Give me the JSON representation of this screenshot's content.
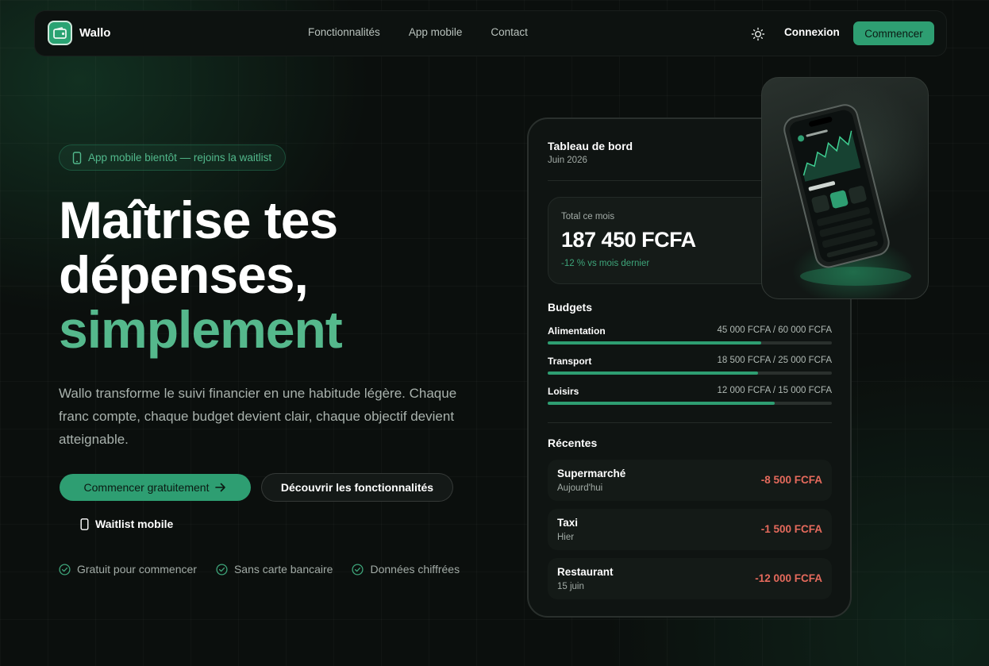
{
  "brand": {
    "name": "Wallo",
    "accent": "#2e9e72"
  },
  "nav": {
    "links": [
      "Fonctionnalités",
      "App mobile",
      "Contact"
    ],
    "theme_icon": "sun-icon",
    "login": "Connexion",
    "start": "Commencer"
  },
  "hero": {
    "pill": "App mobile bientôt — rejoins la waitlist",
    "headline_line1": "Maîtrise tes",
    "headline_line2": "dépenses,",
    "headline_accent": "simplement",
    "lead": "Wallo transforme le suivi financier en une habitude légère. Chaque franc compte, chaque budget devient clair, chaque objectif devient atteignable.",
    "cta_primary": "Commencer gratuitement",
    "cta_secondary": "Découvrir les fonctionnalités",
    "waitlist": "Waitlist mobile",
    "perks": [
      "Gratuit pour commencer",
      "Sans carte bancaire",
      "Données chiffrées"
    ]
  },
  "dashboard": {
    "title": "Tableau de bord",
    "date": "Juin 2026",
    "total_label": "Total ce mois",
    "total_value": "187 450 FCFA",
    "total_delta": "-12 % vs mois dernier",
    "budgets_title": "Budgets",
    "budgets": [
      {
        "label": "Alimentation",
        "amount": "45 000 FCFA / 60 000 FCFA",
        "progress": 0.75
      },
      {
        "label": "Transport",
        "amount": "18 500 FCFA / 25 000 FCFA",
        "progress": 0.74
      },
      {
        "label": "Loisirs",
        "amount": "12 000 FCFA / 15 000 FCFA",
        "progress": 0.8
      }
    ],
    "recent_title": "Récentes",
    "transactions": [
      {
        "name": "Supermarché",
        "date": "Aujourd'hui",
        "amount": "-8 500 FCFA"
      },
      {
        "name": "Taxi",
        "date": "Hier",
        "amount": "-1 500 FCFA"
      },
      {
        "name": "Restaurant",
        "date": "15 juin",
        "amount": "-12 000 FCFA"
      }
    ]
  }
}
